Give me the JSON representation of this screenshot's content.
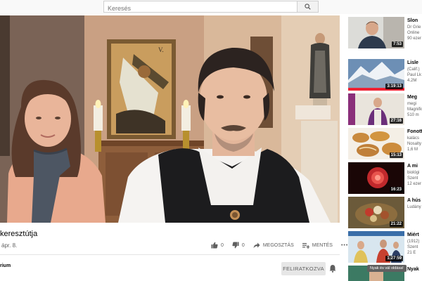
{
  "search": {
    "placeholder": "Keresés"
  },
  "video": {
    "title_fragment": "keresztútja",
    "date_fragment": "ápr. 8.",
    "likes": "0",
    "dislikes": "0",
    "share_label": "MEGOSZTÁS",
    "save_label": "MENTÉS",
    "more_label": "•••"
  },
  "channel": {
    "name_fragment": "rium",
    "subscribe_label": "FELIRATKOZVA"
  },
  "sidebar": {
    "items": [
      {
        "title": "Slon",
        "meta1": "Dr Grie",
        "meta2": "Online",
        "meta3": "90 ezer",
        "duration": "7:53"
      },
      {
        "title": "Lisle",
        "meta1": "(Calif.)",
        "meta2": "Paul Lk",
        "meta3": "4.2M",
        "duration": "3:19:13"
      },
      {
        "title": "Meg",
        "meta1": "megi",
        "meta2": "Magnific",
        "meta3": "510 m",
        "duration": "27:16"
      },
      {
        "title": "Fonott",
        "meta1": "kalács",
        "meta2": "Nosalty",
        "meta3": "1,6 M",
        "duration": "15:13"
      },
      {
        "title": "A mi",
        "meta1": "biológi",
        "meta2": "Szent",
        "meta3": "12 ezer",
        "duration": "16:23"
      },
      {
        "title": "A hús",
        "meta1": "Ludány",
        "meta2": "",
        "meta3": "",
        "duration": "21:22"
      },
      {
        "title": "Miért",
        "meta1": "(1912)",
        "meta2": "Szent",
        "meta3": "21 E",
        "duration": "1:27:59"
      },
      {
        "title": "Nyak",
        "meta1": "",
        "meta2": "",
        "meta3": "",
        "duration": ""
      }
    ],
    "tooltip": "Nyak és vál oldása!"
  }
}
